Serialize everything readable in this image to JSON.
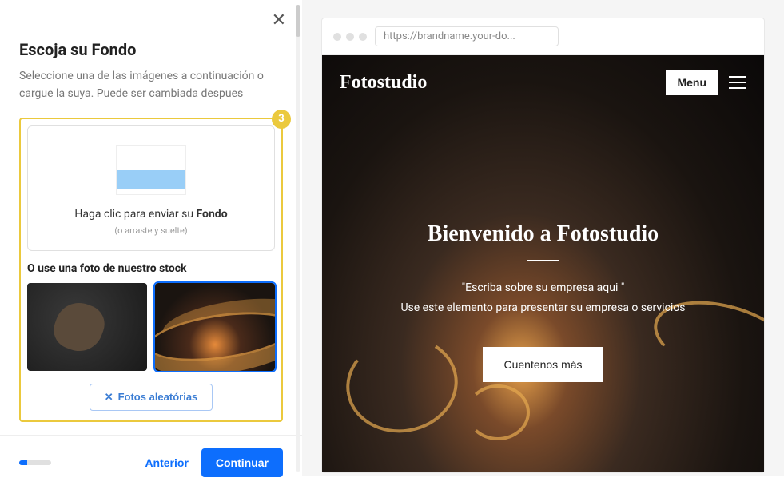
{
  "sidebar": {
    "title": "Escoja su Fondo",
    "subtitle": "Seleccione una de las imágenes a continuación o cargue la suya. Puede ser cambiada despues",
    "step_number": "3",
    "upload": {
      "text_prefix": "Haga clic para enviar su ",
      "text_bold": "Fondo",
      "sub": "(o arraste y suelte)"
    },
    "stock_heading": "O use una foto de nuestro stock",
    "random_btn": "Fotos aleatórias",
    "prev_btn": "Anterior",
    "next_btn": "Continuar"
  },
  "preview": {
    "url": "https://brandname.your-do...",
    "site_title": "Fotostudio",
    "menu_btn": "Menu",
    "hero_title": "Bienvenido a Fotostudio",
    "quote": "\"Escriba sobre su empresa aqui \"",
    "desc": "Use este elemento para presentar su empresa o servicios",
    "cta": "Cuentenos más"
  }
}
